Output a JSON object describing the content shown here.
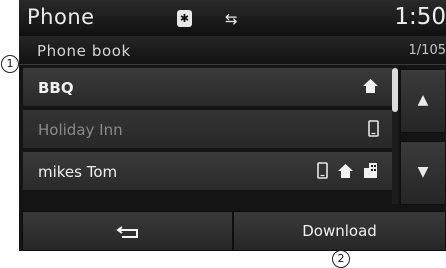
{
  "header": {
    "title": "Phone",
    "time": "1:50",
    "bluetooth_icon": "bluetooth-icon",
    "usb_icon": "usb-icon"
  },
  "subheader": {
    "title": "Phone book",
    "count": "1/105"
  },
  "contacts": [
    {
      "name": "BBQ",
      "icons": [
        "home-icon"
      ],
      "dim": false
    },
    {
      "name": "Holiday Inn",
      "icons": [
        "mobile-phone-icon"
      ],
      "dim": true
    },
    {
      "name": "mikes Tom",
      "icons": [
        "mobile-phone-icon",
        "home-icon",
        "office-icon"
      ],
      "dim": false
    }
  ],
  "scroll": {
    "up_icon": "arrow-up-icon",
    "down_icon": "arrow-down-icon"
  },
  "footer": {
    "back_icon": "back-arrow-icon",
    "download_label": "Download"
  },
  "callouts": {
    "one": "1",
    "two": "2"
  }
}
